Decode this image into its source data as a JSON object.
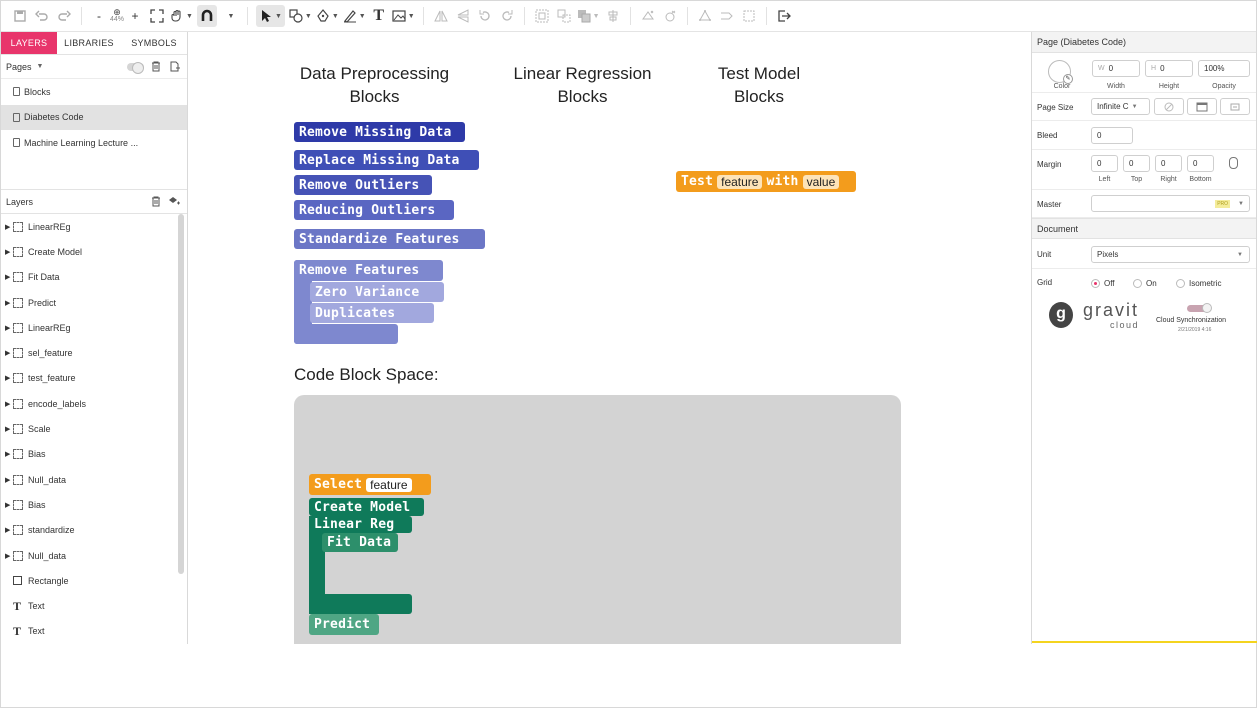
{
  "toolbar": {
    "zoom_level": "44%",
    "icons": [
      "save-icon",
      "undo-icon",
      "redo-icon",
      "zoom-out-icon",
      "zoom-icon",
      "zoom-in-icon",
      "fit-icon",
      "hand-icon",
      "magnet-icon",
      "pointer-icon",
      "shape-icon",
      "pen-icon",
      "brush-icon",
      "text-icon",
      "image-icon",
      "flip-h-icon",
      "flip-v-icon",
      "rotate-left-icon",
      "rotate-right-icon",
      "group-icon",
      "ungroup-icon",
      "arrange-icon",
      "align-icon",
      "boolean-icon",
      "mask-icon",
      "triangle-icon",
      "transform-icon",
      "frame-icon",
      "export-icon"
    ],
    "text_tool": "T"
  },
  "left_panel": {
    "tabs": [
      "LAYERS",
      "LIBRARIES",
      "SYMBOLS"
    ],
    "pages_label": "Pages",
    "pages": [
      "Blocks",
      "Diabetes Code",
      "Machine Learning Lecture ..."
    ],
    "selected_page": "Diabetes Code",
    "layers_label": "Layers",
    "layers": [
      {
        "name": "LinearREg",
        "type": "group"
      },
      {
        "name": "Create Model",
        "type": "group"
      },
      {
        "name": "Fit Data",
        "type": "group"
      },
      {
        "name": "Predict",
        "type": "group"
      },
      {
        "name": "LinearREg",
        "type": "group"
      },
      {
        "name": "sel_feature",
        "type": "group"
      },
      {
        "name": "test_feature",
        "type": "group"
      },
      {
        "name": "encode_labels",
        "type": "group"
      },
      {
        "name": "Scale",
        "type": "group"
      },
      {
        "name": "Bias",
        "type": "group"
      },
      {
        "name": "Null_data",
        "type": "group"
      },
      {
        "name": "Bias",
        "type": "group"
      },
      {
        "name": "standardize",
        "type": "group"
      },
      {
        "name": "Null_data",
        "type": "group"
      },
      {
        "name": "Rectangle",
        "type": "rect"
      },
      {
        "name": "Text",
        "type": "text"
      },
      {
        "name": "Text",
        "type": "text"
      }
    ]
  },
  "canvas": {
    "headings": {
      "preprocessing_1": "Data Preprocessing",
      "preprocessing_2": "Blocks",
      "regression_1": "Linear Regression",
      "regression_2": "Blocks",
      "test_1": "Test Model",
      "test_2": "Blocks"
    },
    "preprocessing_blocks": {
      "remove_missing": "Remove Missing Data",
      "replace_missing": "Replace Missing Data",
      "remove_outliers": "Remove Outliers",
      "reducing_outliers": "Reducing Outliers",
      "standardize": "Standardize Features",
      "remove_features": "Remove Features",
      "zero_variance": "Zero Variance",
      "duplicates": "Duplicates"
    },
    "test_block": {
      "label": "Test",
      "slot1": "feature",
      "mid": "with",
      "slot2": "value"
    },
    "code_space_label": "Code Block Space:",
    "code_blocks": {
      "select": "Select",
      "select_slot": "feature",
      "create_model": "Create Model",
      "linear_reg": "Linear Reg",
      "fit_data": "Fit Data",
      "predict": "Predict"
    },
    "colors": {
      "dark_blue": "#2e3aa8",
      "blue": "#3f4fb6",
      "mid_blue": "#5a66c2",
      "light_blue": "#7680cc",
      "lighter_blue": "#9ea4dc",
      "orange": "#f39c1c",
      "dark_green": "#0f7a5a",
      "green": "#2d8f6b",
      "light_green": "#4fa684",
      "code_bg": "#d3d3d3",
      "accent_pink": "#e8356b"
    }
  },
  "right_panel": {
    "title": "Page (Diabetes Code)",
    "color_label": "Color",
    "width_label": "Width",
    "height_label": "Height",
    "opacity_label": "Opacity",
    "w_prefix": "W",
    "w_value": "0",
    "h_prefix": "H",
    "h_value": "0",
    "opacity_value": "100%",
    "page_size_label": "Page Size",
    "page_size_value": "Infinite C",
    "bleed_label": "Bleed",
    "bleed_value": "0",
    "margin_label": "Margin",
    "margins": {
      "left": "0",
      "top": "0",
      "right": "0",
      "bottom": "0"
    },
    "margin_sub": {
      "left": "Left",
      "top": "Top",
      "right": "Right",
      "bottom": "Bottom"
    },
    "master_label": "Master",
    "master_badge": "PRO",
    "document_label": "Document",
    "unit_label": "Unit",
    "unit_value": "Pixels",
    "grid_label": "Grid",
    "grid_options": [
      "Off",
      "On",
      "Isometric"
    ],
    "grid_selected": "Off",
    "logo_text": "gravit",
    "logo_sub": "cloud",
    "cloud_sync_label": "Cloud Synchronization",
    "cloud_sync_date": "2/21/2019 4:16"
  }
}
